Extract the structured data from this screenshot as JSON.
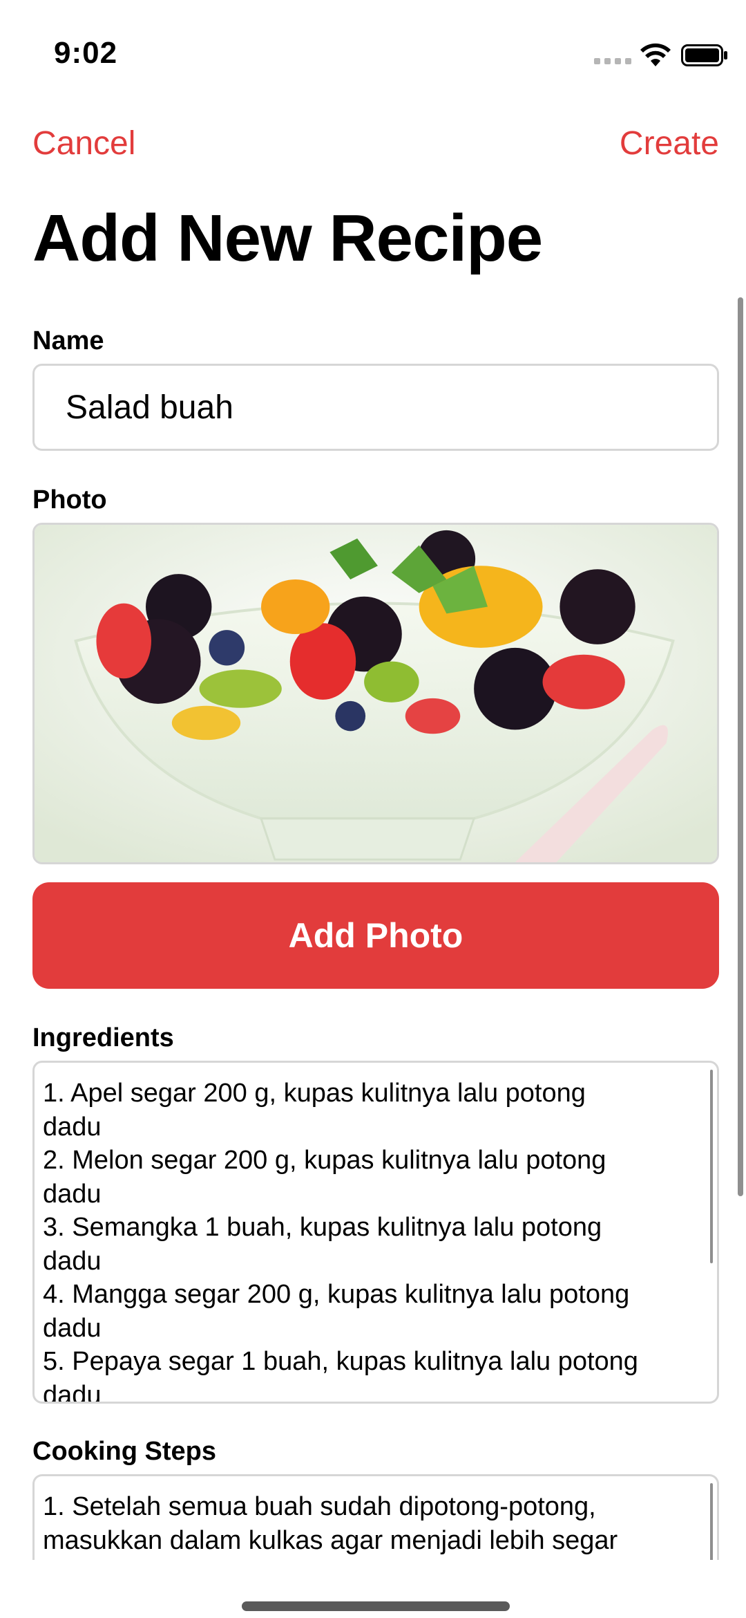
{
  "status": {
    "time": "9:02"
  },
  "nav": {
    "cancel_label": "Cancel",
    "create_label": "Create"
  },
  "title": "Add New Recipe",
  "form": {
    "name_label": "Name",
    "name_value": "Salad buah",
    "photo_label": "Photo",
    "add_photo_label": "Add Photo",
    "ingredients_label": "Ingredients",
    "ingredients_lines": [
      "1. Apel segar 200 g, kupas kulitnya lalu potong",
      "dadu",
      "2. Melon segar 200 g, kupas kulitnya lalu potong",
      "dadu",
      "3. Semangka 1 buah, kupas kulitnya lalu potong",
      "dadu",
      "4. Mangga segar 200 g, kupas kulitnya lalu potong",
      "dadu",
      "5. Pepaya segar 1 buah, kupas kulitnya lalu potong",
      "dadu"
    ],
    "steps_label": "Cooking Steps",
    "steps_lines": [
      "1. Setelah semua buah sudah dipotong-potong,",
      "masukkan dalam kulkas agar menjadi lebih segar"
    ]
  },
  "colors": {
    "accent": "#e23c3c",
    "border": "#d6d6d6"
  },
  "icons": [
    "signal-icon",
    "wifi-icon",
    "battery-icon"
  ]
}
